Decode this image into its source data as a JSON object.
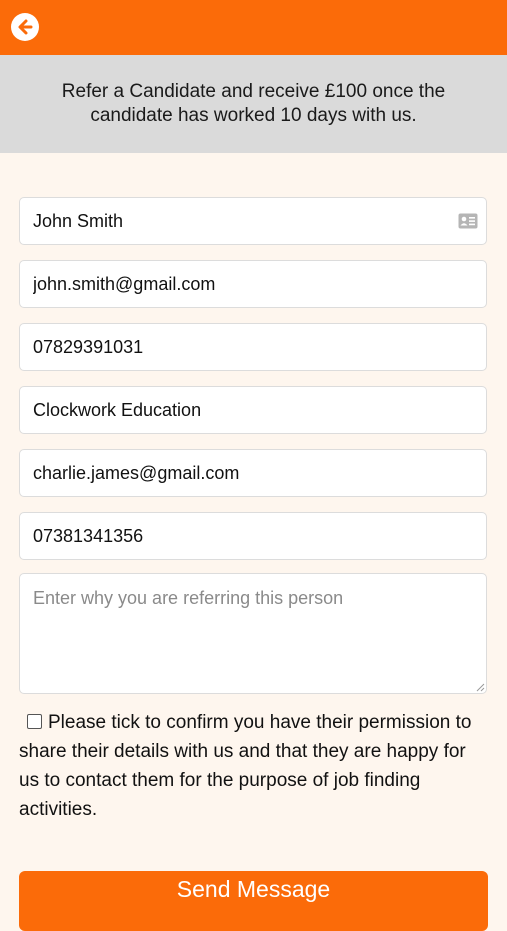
{
  "header": {
    "back_icon": "arrow-left-circle-icon",
    "accent_color": "#fb6b09"
  },
  "banner": {
    "text": "Refer a Candidate and receive £100 once the candidate has worked 10 days with us."
  },
  "form": {
    "candidate_name": "John Smith",
    "candidate_name_icon": "contact-card-icon",
    "candidate_email": "john.smith@gmail.com",
    "candidate_phone": "07829391031",
    "referrer_company": "Clockwork Education",
    "referrer_email": "charlie.james@gmail.com",
    "referrer_phone": "07381341356",
    "reason_placeholder": "Enter why you are referring this person",
    "consent_checked": false,
    "consent_text": "Please tick to confirm you have their permission to share their details with us and that they are happy for us to contact them for the purpose of job finding activities.",
    "submit_label": "Send Message"
  }
}
